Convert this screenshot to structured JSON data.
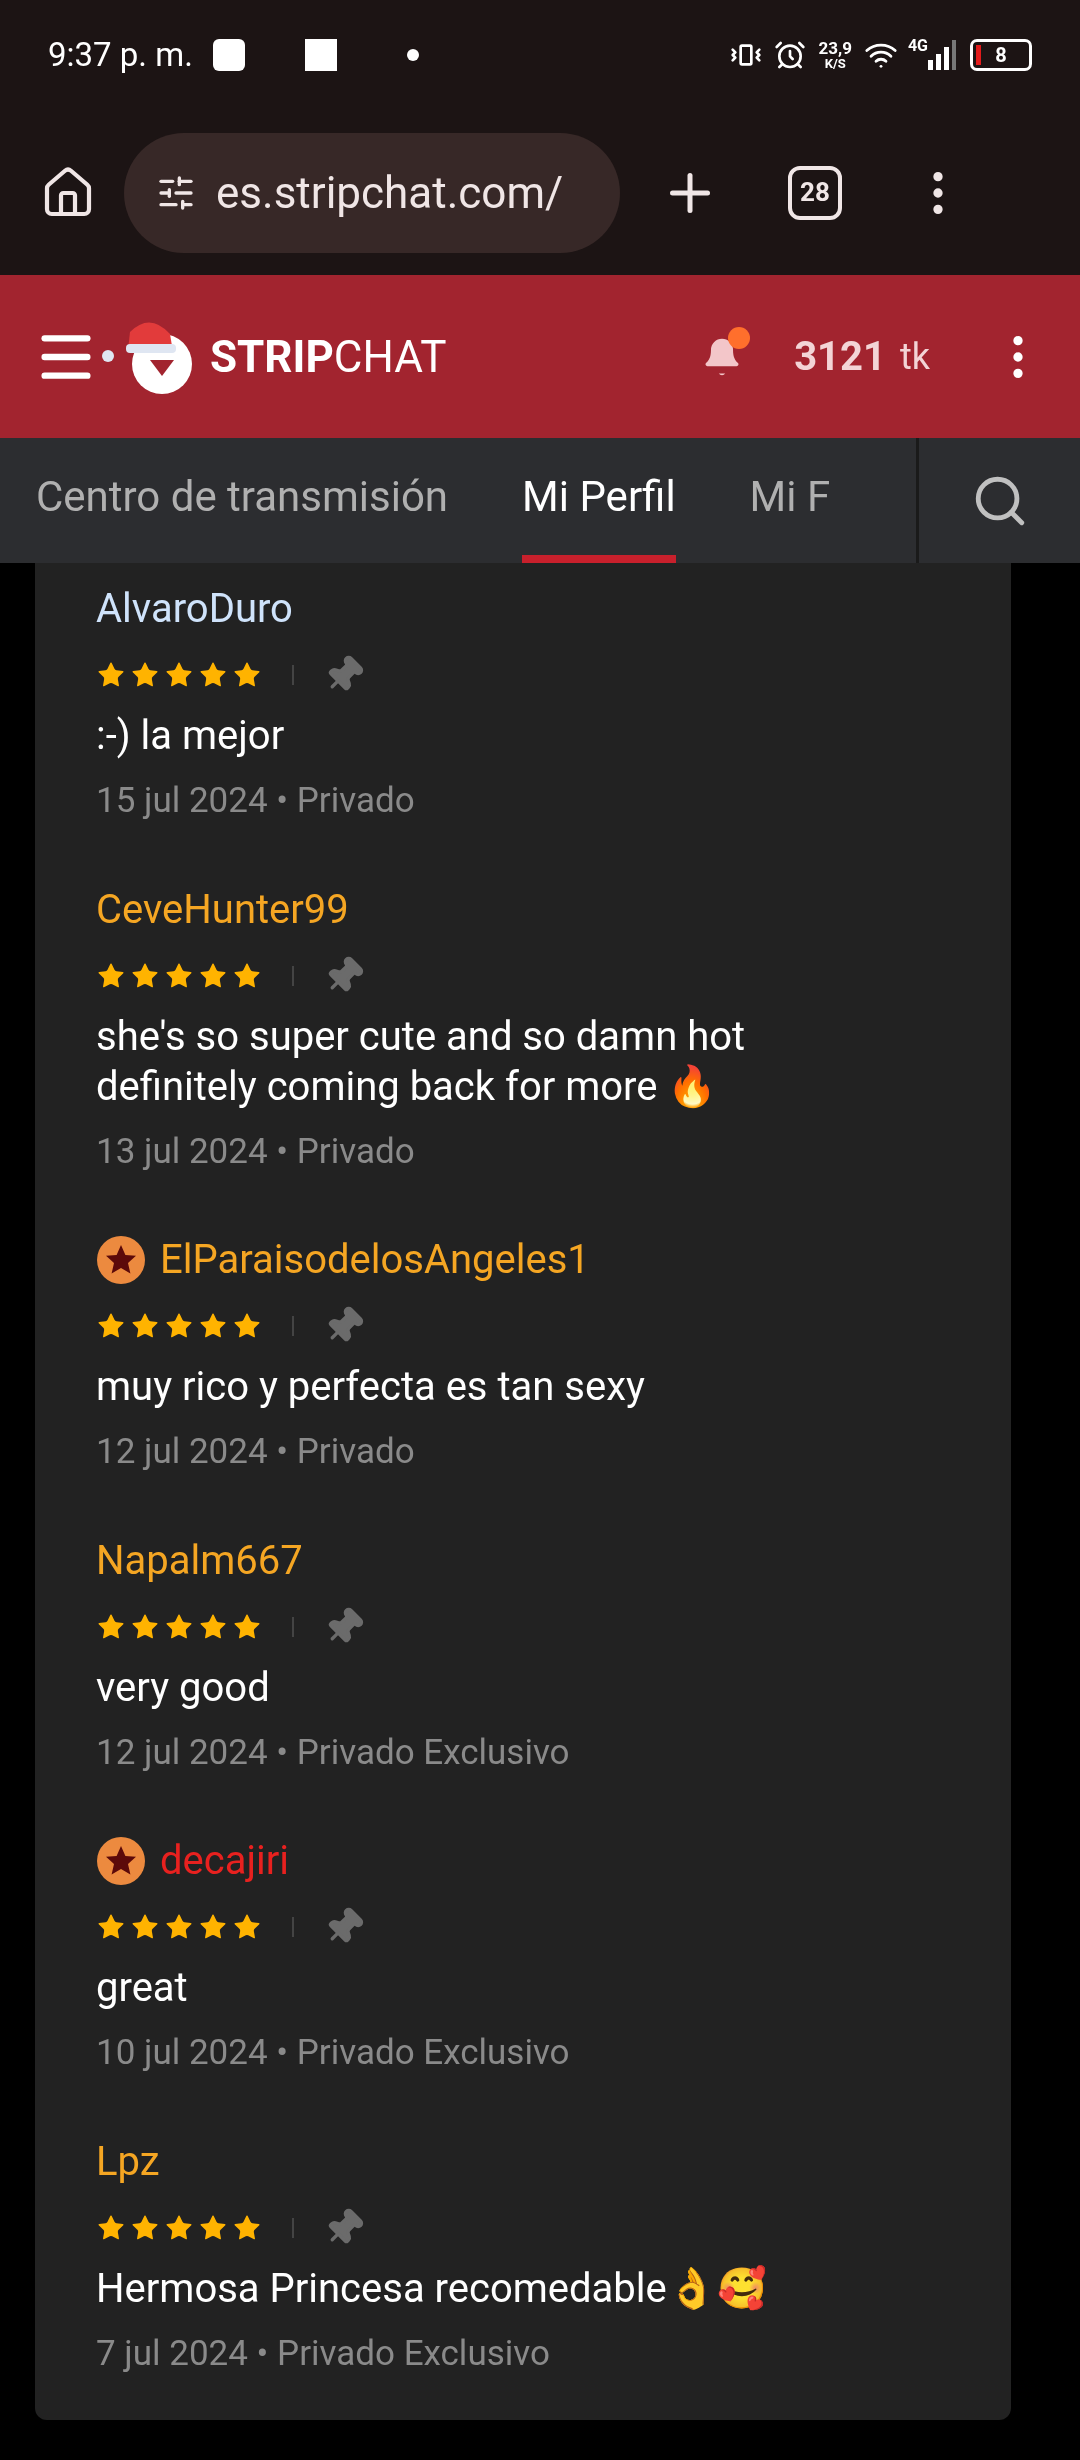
{
  "status_bar": {
    "time": "9:37 p. m.",
    "speed": "23,9",
    "speed_unit": "K/S",
    "network": "4G",
    "battery": "8"
  },
  "browser": {
    "url": "es.stripchat.com/",
    "tab_count": "28"
  },
  "header": {
    "logo": "**STRIP**CHAT",
    "tokens": "3121",
    "tokens_unit": "tk",
    "notification": true
  },
  "tabs": [
    {
      "label": "Centro de transmisión",
      "selected": false
    },
    {
      "label": "Mi Perfil",
      "selected": true
    },
    {
      "label": "Mi F",
      "selected": false
    }
  ],
  "reviews": [
    {
      "user": "AlvaroDuro",
      "color": "#cfe3fb",
      "badge": false,
      "stars": 5,
      "text": ":-) la mejor",
      "meta": "15 jul 2024 • Privado"
    },
    {
      "user": "CeveHunter99",
      "color": "#f5a623",
      "badge": false,
      "stars": 5,
      "text": "she's so super cute and so damn hot definitely coming back for more 🔥",
      "meta": "13 jul 2024 • Privado"
    },
    {
      "user": "ElParaisodelosAngeles1",
      "color": "#f5a623",
      "badge": true,
      "stars": 5,
      "text": "muy rico y perfecta es tan sexy",
      "meta": "12 jul 2024 • Privado"
    },
    {
      "user": "Napalm667",
      "color": "#f5a623",
      "badge": false,
      "stars": 5,
      "text": "very good",
      "meta": "12 jul 2024 • Privado Exclusivo"
    },
    {
      "user": "decajiri",
      "color": "#e8211f",
      "badge": true,
      "stars": 5,
      "text": "great",
      "meta": "10 jul 2024 • Privado Exclusivo"
    },
    {
      "user": "Lpz",
      "color": "#f5a623",
      "badge": false,
      "stars": 5,
      "text": "Hermosa Princesa recomedable👌🥰",
      "meta": "7 jul 2024 • Privado Exclusivo"
    }
  ]
}
